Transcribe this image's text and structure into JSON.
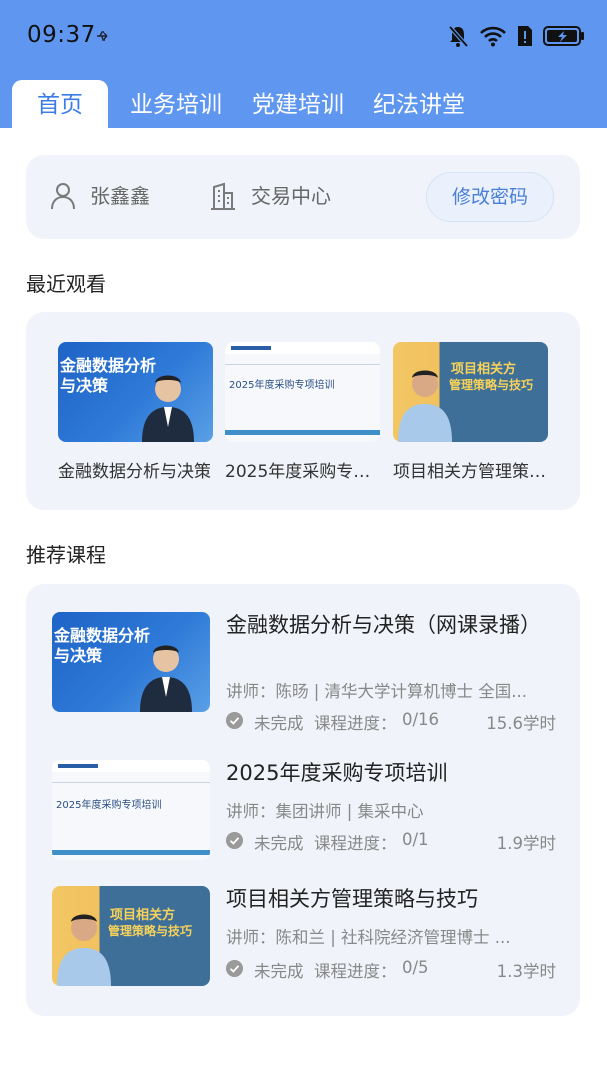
{
  "status_bar": {
    "time": "09:37"
  },
  "tabs": [
    {
      "label": "首页"
    },
    {
      "label": "业务培训"
    },
    {
      "label": "党建培训"
    },
    {
      "label": "纪法讲堂"
    }
  ],
  "user": {
    "name": "张鑫鑫",
    "department": "交易中心",
    "change_password_label": "修改密码"
  },
  "recent": {
    "title": "最近观看",
    "items": [
      {
        "title": "金融数据分析与决策",
        "thumb_text": [
          "金融数据分析",
          "与决策"
        ]
      },
      {
        "title": "2025年度采购专项培训",
        "thumb_text": [
          "2025年度采购专项培训"
        ]
      },
      {
        "title": "项目相关方管理策略与技巧",
        "thumb_text": [
          "项目相关方",
          "管理策略与技巧"
        ]
      }
    ]
  },
  "recommended": {
    "title": "推荐课程",
    "courses": [
      {
        "title": "金融数据分析与决策（网课录播）",
        "teacher": "讲师：陈旸 | 清华大学计算机博士 全国...",
        "status": "未完成",
        "progress_label": "课程进度：",
        "progress": "0/16",
        "hours": "15.6学时"
      },
      {
        "title": "2025年度采购专项培训",
        "teacher": "讲师：集团讲师 | 集采中心",
        "status": "未完成",
        "progress_label": "课程进度：",
        "progress": "0/1",
        "hours": "1.9学时"
      },
      {
        "title": "项目相关方管理策略与技巧",
        "teacher": "讲师：陈和兰 | 社科院经济管理博士 ...",
        "status": "未完成",
        "progress_label": "课程进度：",
        "progress": "0/5",
        "hours": "1.3学时"
      }
    ]
  },
  "icons": {
    "user": "user-icon",
    "building": "building-icon",
    "check": "check-circle-icon",
    "bell_off": "bell-off-icon",
    "wifi": "wifi-icon",
    "battery": "battery-charging-icon"
  },
  "colors": {
    "header": "#5f97f0",
    "accent": "#3d7ce8",
    "card": "#f0f4fa"
  }
}
